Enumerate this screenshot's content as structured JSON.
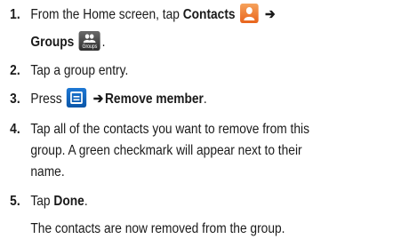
{
  "steps": [
    {
      "number": "1.",
      "line1_prefix": "From the Home screen, tap ",
      "line1_bold": "Contacts",
      "arrow": "➔",
      "line2_bold": "Groups",
      "groups_icon_label": "Groups"
    },
    {
      "number": "2.",
      "text": "Tap a group entry."
    },
    {
      "number": "3.",
      "prefix": "Press ",
      "arrow": "➔",
      "bold": "Remove member",
      "suffix": "."
    },
    {
      "number": "4.",
      "line1": "Tap all of the contacts you want to remove from this",
      "line2": "group. A green checkmark will appear next to their",
      "line3": "name."
    },
    {
      "number": "5.",
      "prefix": "Tap ",
      "bold": "Done",
      "suffix": ".",
      "result": "The contacts are now removed from the group."
    }
  ]
}
